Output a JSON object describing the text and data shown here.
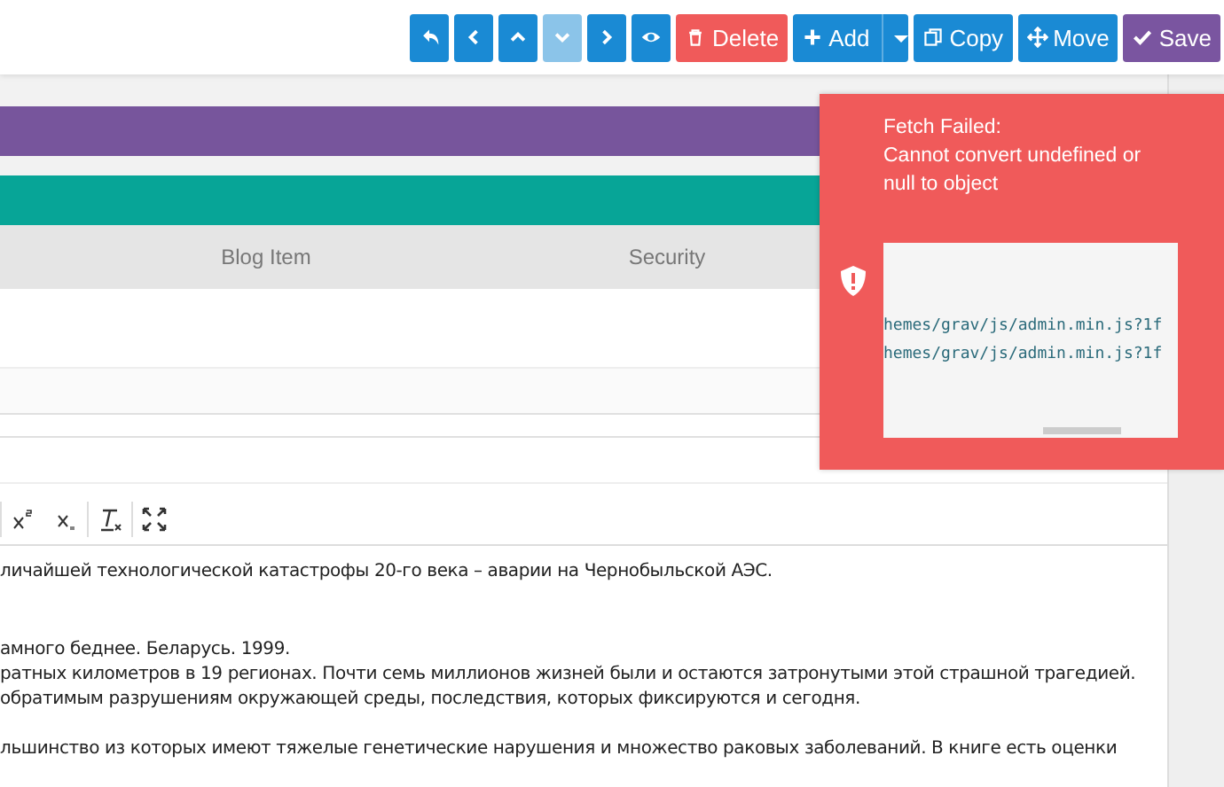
{
  "toolbar": {
    "buttons": [
      {
        "kind": "undo",
        "disabled": false
      },
      {
        "kind": "prev",
        "disabled": false
      },
      {
        "kind": "up",
        "disabled": false
      },
      {
        "kind": "down",
        "disabled": true
      },
      {
        "kind": "next",
        "disabled": false
      },
      {
        "kind": "preview",
        "disabled": false
      },
      {
        "kind": "delete",
        "label": "Delete",
        "disabled": false
      },
      {
        "kind": "add",
        "label": "Add",
        "disabled": false
      },
      {
        "kind": "copy",
        "label": "Copy",
        "disabled": false
      },
      {
        "kind": "move",
        "label": "Move",
        "disabled": false
      },
      {
        "kind": "save",
        "label": "Save",
        "disabled": false
      }
    ]
  },
  "tabs": [
    {
      "label": "Blog Item",
      "selected": false
    },
    {
      "label": "Security",
      "selected": false
    }
  ],
  "editor": {
    "tools": [
      {
        "kind": "superscript"
      },
      {
        "kind": "subscript"
      },
      {
        "kind": "clear-format"
      },
      {
        "kind": "fullscreen"
      }
    ],
    "paragraphs": [
      [
        "личайшей технологической катастрофы 20-го века – аварии на Чернобыльской АЭС."
      ],
      [
        "амного беднее. Беларусь. 1999.",
        "ратных километров в 19 регионах. Почти семь миллионов жизней были и остаются затронутыми этой страшной трагедией.",
        "обратимым разрушениям окружающей среды, последствия, которых фиксируются и сегодня."
      ],
      [
        "льшинство из которых имеют тяжелые генетические нарушения и множество раковых заболеваний. В книге есть оценки"
      ]
    ]
  },
  "toast": {
    "title": "Fetch Failed:",
    "message": "Cannot convert undefined or null to object",
    "trace": [
      "hemes/grav/js/admin.min.js?1f",
      "hemes/grav/js/admin.min.js?1f"
    ]
  }
}
